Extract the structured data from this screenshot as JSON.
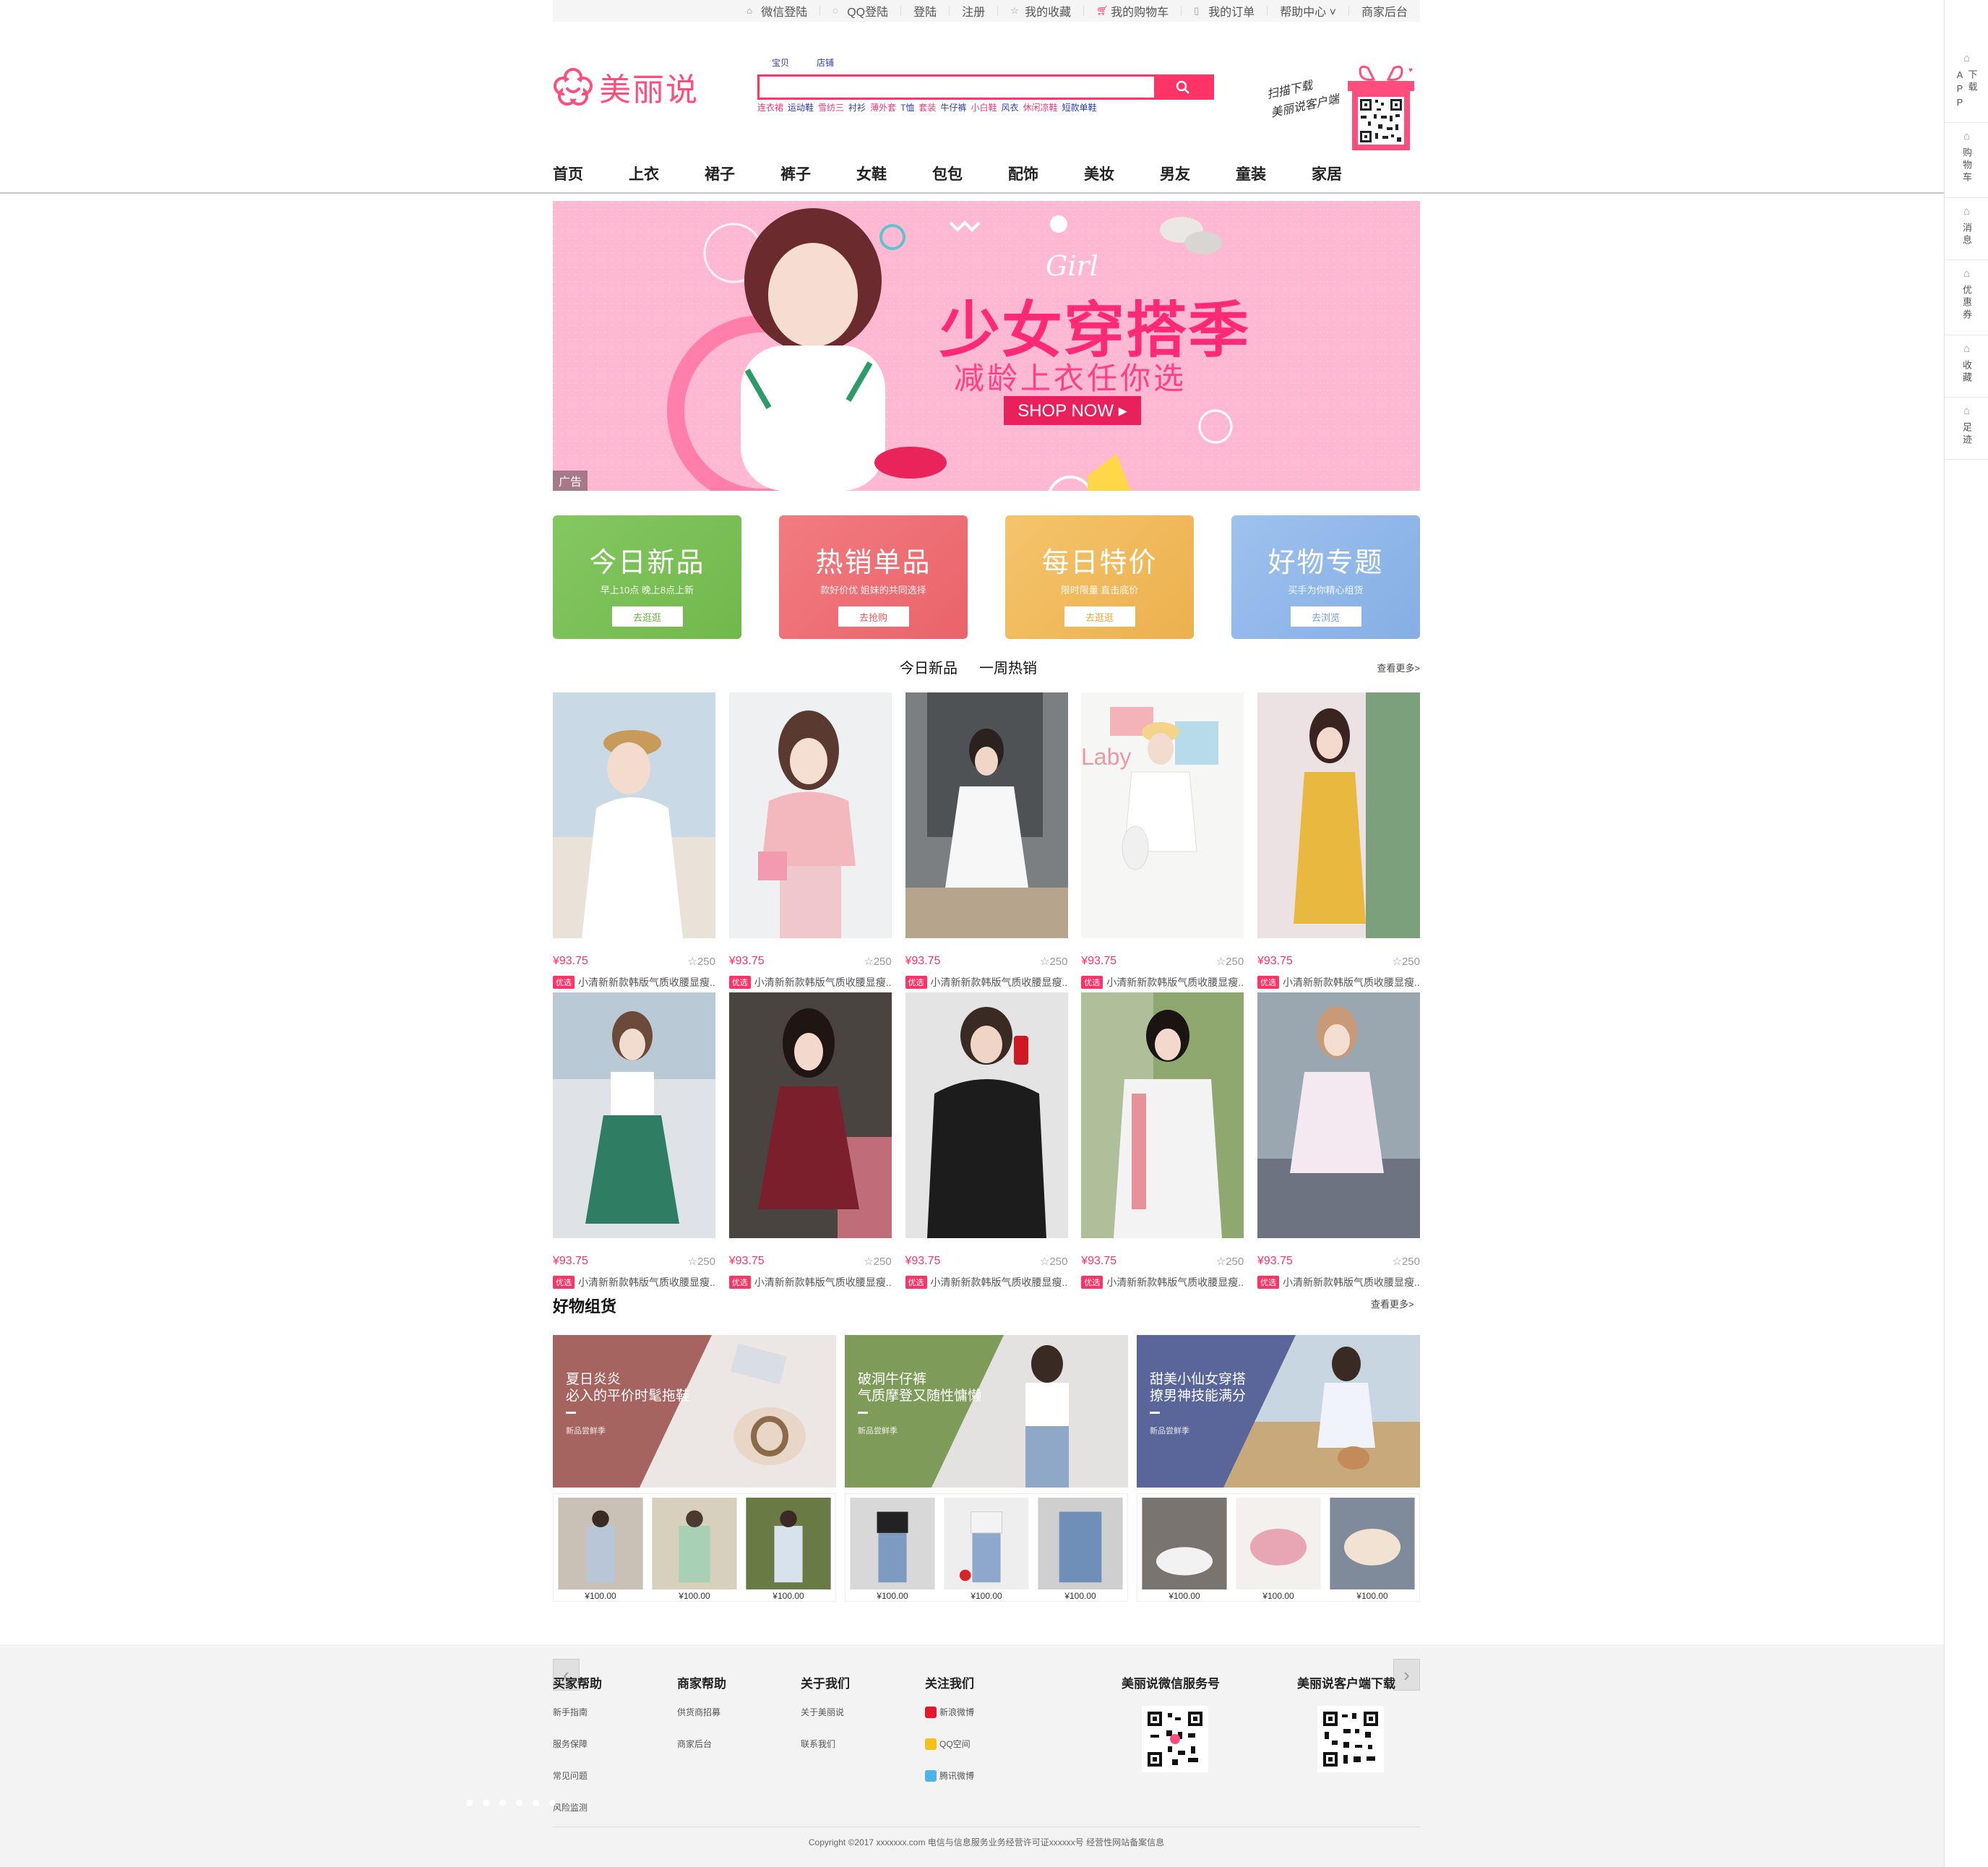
{
  "topbar": {
    "links": [
      {
        "label": "微信登陆",
        "icon": "home-icon"
      },
      {
        "label": "QQ登陆",
        "icon": "qq-icon"
      },
      {
        "label": "登陆",
        "icon": ""
      },
      {
        "label": "注册",
        "icon": ""
      },
      {
        "label": "我的收藏",
        "icon": "star-icon"
      },
      {
        "label": "我的购物车",
        "icon": "cart-icon"
      },
      {
        "label": "我的订单",
        "icon": "order-icon"
      },
      {
        "label": "帮助中心 ˅",
        "icon": ""
      },
      {
        "label": "商家后台",
        "icon": ""
      }
    ]
  },
  "header": {
    "logo_text": "美丽说",
    "search_tabs": [
      "宝贝",
      "店铺"
    ],
    "search_placeholder": "",
    "hot_words": [
      "连衣裙",
      "运动鞋",
      "雪纺三",
      "衬衫",
      "薄外套",
      "T恤",
      "套装",
      "牛仔裤",
      "小白鞋",
      "风衣",
      "休闲凉鞋",
      "短款单鞋"
    ],
    "app_promo_line1": "扫描下载",
    "app_promo_line2": "美丽说客户端"
  },
  "nav": [
    "首页",
    "上衣",
    "裙子",
    "裤子",
    "女鞋",
    "包包",
    "配饰",
    "美妆",
    "男友",
    "童装",
    "家居"
  ],
  "sidebar": [
    {
      "label": "下载APP",
      "icon": "phone-icon"
    },
    {
      "label": "购物车",
      "icon": "cart-icon"
    },
    {
      "label": "消息",
      "icon": "message-icon"
    },
    {
      "label": "优惠券",
      "icon": "coupon-icon"
    },
    {
      "label": "收藏",
      "icon": "favorite-icon"
    },
    {
      "label": "足迹",
      "icon": "footprint-icon"
    }
  ],
  "banner": {
    "tag": "Girl",
    "title": "少女穿搭季",
    "subtitle": "减龄上衣任你选",
    "cta": "SHOP NOW ▸",
    "ad_label": "广告",
    "bg_color": "#ffb8d2"
  },
  "cards": [
    {
      "title": "今日新品",
      "sub": "早上10点 晚上8点上新",
      "btn": "去逛逛",
      "color": "#7cc157",
      "btn_color": "#6cb245"
    },
    {
      "title": "热销单品",
      "sub": "款好价优 姐妹的共同选择",
      "btn": "去抢购",
      "color": "#ee6f74",
      "btn_color": "#e65a62"
    },
    {
      "title": "每日特价",
      "sub": "限时限量 直击底价",
      "btn": "去逛逛",
      "color": "#f2b95a",
      "btn_color": "#e9a83c"
    },
    {
      "title": "好物专题",
      "sub": "买手为你精心组货",
      "btn": "去浏览",
      "color": "#8fb8ea",
      "btn_color": "#6f9ed8"
    }
  ],
  "tabs": [
    "今日新品",
    "一周热销"
  ],
  "more_label": "查看更多>",
  "products_row1": [
    {
      "price": "¥93.75",
      "fav": "☆250",
      "tag": "优选",
      "name": "小清新新款韩版气质收腰显瘦..."
    },
    {
      "price": "¥93.75",
      "fav": "☆250",
      "tag": "优选",
      "name": "小清新新款韩版气质收腰显瘦..."
    },
    {
      "price": "¥93.75",
      "fav": "☆250",
      "tag": "优选",
      "name": "小清新新款韩版气质收腰显瘦..."
    },
    {
      "price": "¥93.75",
      "fav": "☆250",
      "tag": "优选",
      "name": "小清新新款韩版气质收腰显瘦..."
    },
    {
      "price": "¥93.75",
      "fav": "☆250",
      "tag": "优选",
      "name": "小清新新款韩版气质收腰显瘦..."
    }
  ],
  "products_row2": [
    {
      "price": "¥93.75",
      "fav": "☆250",
      "tag": "优选",
      "name": "小清新新款韩版气质收腰显瘦..."
    },
    {
      "price": "¥93.75",
      "fav": "☆250",
      "tag": "优选",
      "name": "小清新新款韩版气质收腰显瘦..."
    },
    {
      "price": "¥93.75",
      "fav": "☆250",
      "tag": "优选",
      "name": "小清新新款韩版气质收腰显瘦..."
    },
    {
      "price": "¥93.75",
      "fav": "☆250",
      "tag": "优选",
      "name": "小清新新款韩版气质收腰显瘦..."
    },
    {
      "price": "¥93.75",
      "fav": "☆250",
      "tag": "优选",
      "name": "小清新新款韩版气质收腰显瘦..."
    }
  ],
  "bundles_title": "好物组货",
  "bundles": [
    {
      "line1": "夏日炎炎",
      "line2": "必入的平价时髦拖鞋",
      "small": "新品尝鲜季",
      "color": "#a66460",
      "prices": [
        "¥100.00",
        "¥100.00",
        "¥100.00"
      ]
    },
    {
      "line1": "破洞牛仔裤",
      "line2": "气质摩登又随性慵懒",
      "small": "新品尝鲜季",
      "color": "#7f9b5a",
      "prices": [
        "¥100.00",
        "¥100.00",
        "¥100.00"
      ]
    },
    {
      "line1": "甜美小仙女穿搭",
      "line2": "撩男神技能满分",
      "small": "新品尝鲜季",
      "color": "#5a6599",
      "prices": [
        "¥100.00",
        "¥100.00",
        "¥100.00"
      ]
    }
  ],
  "footer": {
    "cols": [
      {
        "title": "买家帮助",
        "links": [
          "新手指南",
          "服务保障",
          "常见问题",
          "风险监测"
        ]
      },
      {
        "title": "商家帮助",
        "links": [
          "供货商招募",
          "商家后台"
        ]
      },
      {
        "title": "关于我们",
        "links": [
          "关于美丽说",
          "联系我们"
        ]
      },
      {
        "title": "关注我们",
        "links": [
          "新浪微博",
          "QQ空间",
          "腾讯微博"
        ]
      }
    ],
    "wechat_title": "美丽说微信服务号",
    "app_title": "美丽说客户端下载",
    "copyright": "Copyright ©2017 xxxxxxx.com 电信与信息服务业务经营许可证xxxxxx号 经营性网站备案信息"
  }
}
